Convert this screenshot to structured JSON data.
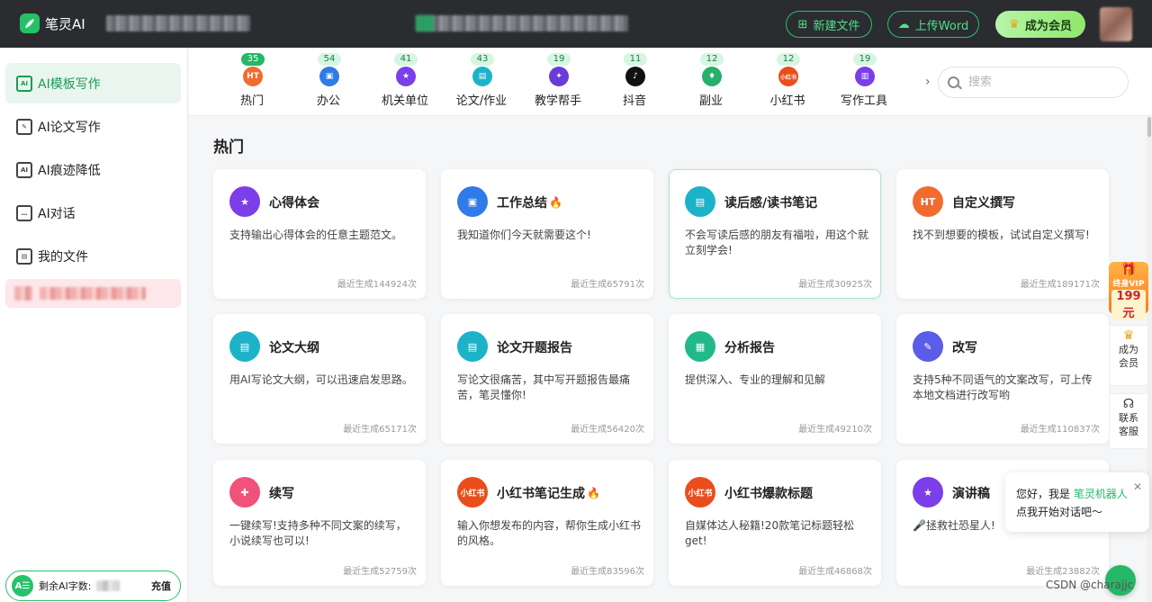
{
  "header": {
    "brand": "笔灵AI",
    "new_file": "新建文件",
    "upload_word": "上传Word",
    "become_vip": "成为会员"
  },
  "sidebar": {
    "items": [
      {
        "label": "AI模板写作",
        "icon": "AI"
      },
      {
        "label": "AI论文写作",
        "icon": "✎"
      },
      {
        "label": "AI痕迹降低",
        "icon": "AI"
      },
      {
        "label": "AI对话",
        "icon": "…"
      },
      {
        "label": "我的文件",
        "icon": "▤"
      }
    ],
    "quota_label": "剩余AI字数:",
    "quota_badge": "A☰",
    "recharge": "充值"
  },
  "categories": [
    {
      "label": "热门",
      "count": "35",
      "color": "#f26b2e",
      "glyph": "HT"
    },
    {
      "label": "办公",
      "count": "54",
      "color": "#2f7be8",
      "glyph": "▣"
    },
    {
      "label": "机关单位",
      "count": "41",
      "color": "#7b3ee8",
      "glyph": "★"
    },
    {
      "label": "论文/作业",
      "count": "43",
      "color": "#1cb3c9",
      "glyph": "▤"
    },
    {
      "label": "教学帮手",
      "count": "19",
      "color": "#6a3bd8",
      "glyph": "✦"
    },
    {
      "label": "抖音",
      "count": "11",
      "color": "#111111",
      "glyph": "♪"
    },
    {
      "label": "副业",
      "count": "12",
      "color": "#26b06a",
      "glyph": "♦"
    },
    {
      "label": "小红书",
      "count": "12",
      "color": "#ea4e1c",
      "glyph": "小红书"
    },
    {
      "label": "写作工具",
      "count": "19",
      "color": "#7b3ee8",
      "glyph": "▥"
    }
  ],
  "search": {
    "placeholder": "搜索"
  },
  "section_title": "热门",
  "cards": [
    {
      "title": "心得体会",
      "hot": false,
      "desc": "支持输出心得体会的任意主题范文。",
      "count": "最近生成144924次",
      "color": "#7b3ee8",
      "glyph": "★"
    },
    {
      "title": "工作总结",
      "hot": true,
      "desc": "我知道你们今天就需要这个!",
      "count": "最近生成65791次",
      "color": "#2f7be8",
      "glyph": "▣"
    },
    {
      "title": "读后感/读书笔记",
      "hot": false,
      "desc": "不会写读后感的朋友有福啦，用这个就立刻学会!",
      "count": "最近生成30925次",
      "color": "#1cb3c9",
      "glyph": "▤"
    },
    {
      "title": "自定义撰写",
      "hot": false,
      "desc": "找不到想要的模板，试试自定义撰写!",
      "count": "最近生成189171次",
      "color": "#f26b2e",
      "glyph": "HT"
    },
    {
      "title": "论文大纲",
      "hot": false,
      "desc": "用AI写论文大纲，可以迅速启发思路。",
      "count": "最近生成65171次",
      "color": "#1cb3c9",
      "glyph": "▤"
    },
    {
      "title": "论文开题报告",
      "hot": false,
      "desc": "写论文很痛苦，其中写开题报告最痛苦，笔灵懂你!",
      "count": "最近生成56420次",
      "color": "#1cb3c9",
      "glyph": "▤"
    },
    {
      "title": "分析报告",
      "hot": false,
      "desc": "提供深入、专业的理解和见解",
      "count": "最近生成49210次",
      "color": "#22b98a",
      "glyph": "▦"
    },
    {
      "title": "改写",
      "hot": false,
      "desc": "支持5种不同语气的文案改写，可上传本地文档进行改写哟",
      "count": "最近生成110837次",
      "color": "#5a5de8",
      "glyph": "✎"
    },
    {
      "title": "续写",
      "hot": false,
      "desc": "一键续写!支持多种不同文案的续写，小说续写也可以!",
      "count": "最近生成52759次",
      "color": "#f0527a",
      "glyph": "✚"
    },
    {
      "title": "小红书笔记生成",
      "hot": true,
      "desc": "输入你想发布的内容，帮你生成小红书的风格。",
      "count": "最近生成83596次",
      "color": "#ea4e1c",
      "glyph": "小红书"
    },
    {
      "title": "小红书爆款标题",
      "hot": false,
      "desc": "自媒体达人秘籍!20款笔记标题轻松get!",
      "count": "最近生成46868次",
      "color": "#ea4e1c",
      "glyph": "小红书"
    },
    {
      "title": "演讲稿",
      "hot": false,
      "desc": "🎤拯救社恐星人!",
      "count": "最近生成23882次",
      "color": "#7b3ee8",
      "glyph": "★"
    }
  ],
  "float": {
    "vip_line1": "终身VIP",
    "vip_price": "199元",
    "tool_vip": "成为会员",
    "tool_cs": "联系客服",
    "chat_greeting_a": "您好，我是",
    "chat_robot": "笔灵机器人",
    "chat_greeting_b": "点我开始对话吧～",
    "watermark": "CSDN @charajjc"
  },
  "colors": {
    "accent": "#25b866",
    "topbar": "#2a2c30"
  }
}
